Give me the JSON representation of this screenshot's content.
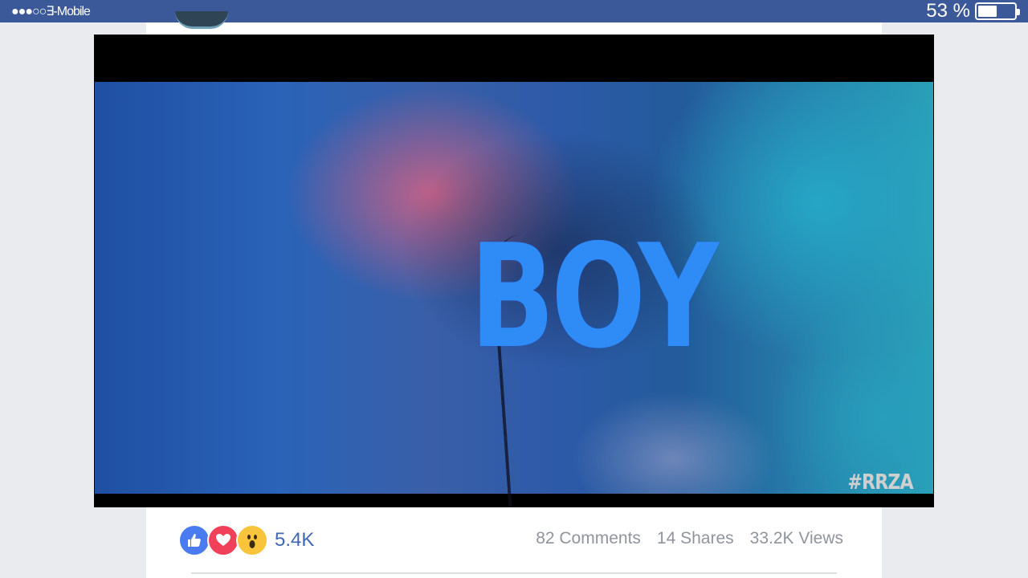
{
  "status_bar": {
    "carrier": "●●●○○∃-Mobile",
    "battery_percent": "53 %",
    "battery_level": 0.53
  },
  "video": {
    "overlay_text": "BOY",
    "watermark": "#RRZA"
  },
  "reactions": {
    "icons": [
      "like-icon",
      "love-icon",
      "wow-icon"
    ],
    "count": "5.4K"
  },
  "stats": {
    "comments": "82 Comments",
    "shares": "14 Shares",
    "views": "33.2K Views"
  },
  "colors": {
    "status_bar": "#3b5998",
    "link_blue": "#4267b2",
    "muted_text": "#90949c"
  }
}
